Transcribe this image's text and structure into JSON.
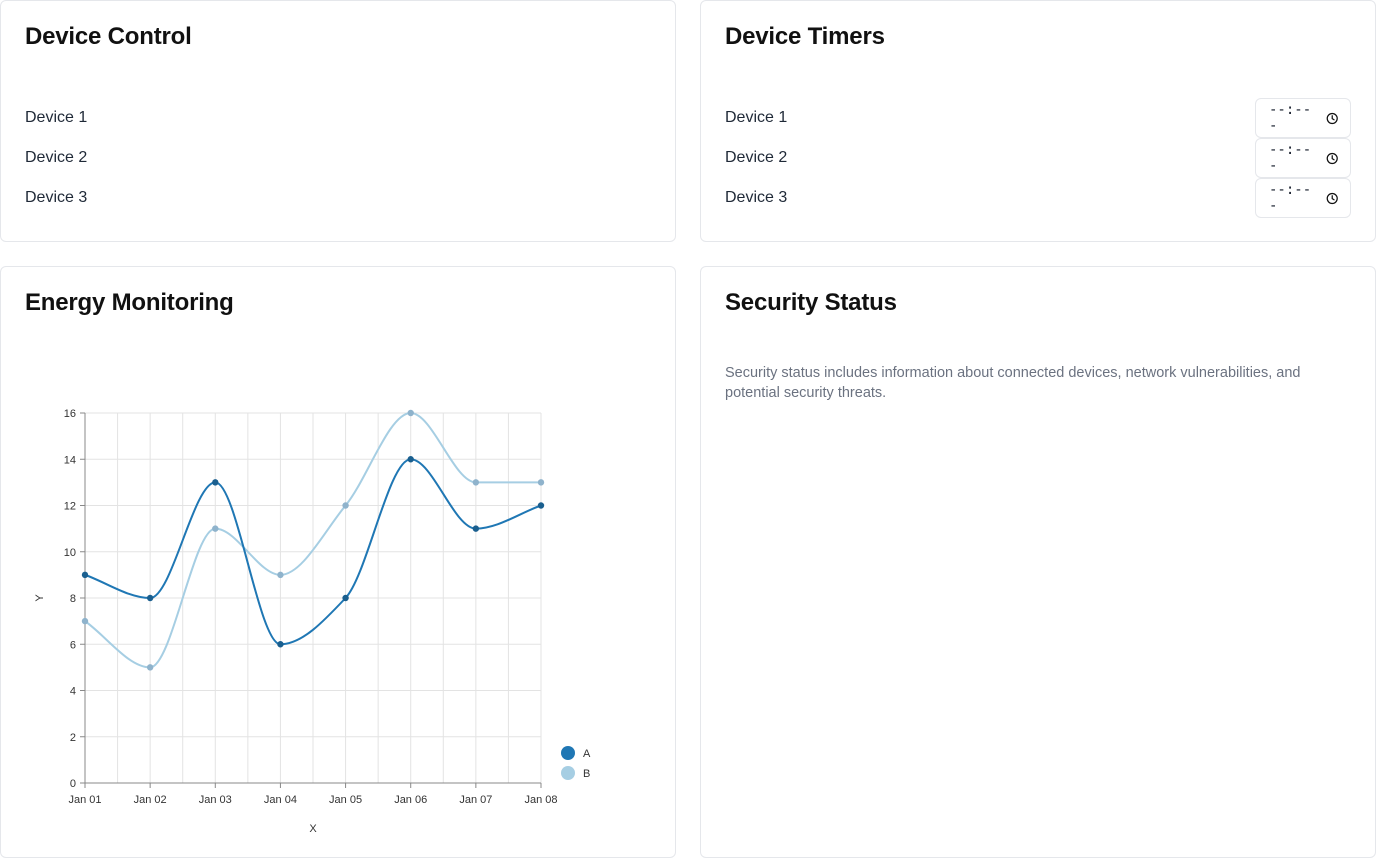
{
  "device_control": {
    "title": "Device Control",
    "devices": [
      "Device 1",
      "Device 2",
      "Device 3"
    ]
  },
  "device_timers": {
    "title": "Device Timers",
    "devices": [
      {
        "label": "Device 1",
        "time_placeholder": "--:-- -"
      },
      {
        "label": "Device 2",
        "time_placeholder": "--:-- -"
      },
      {
        "label": "Device 3",
        "time_placeholder": "--:-- -"
      }
    ],
    "time_icon": "clock-icon"
  },
  "energy_monitoring": {
    "title": "Energy Monitoring"
  },
  "security_status": {
    "title": "Security Status",
    "description": "Security status includes information about connected devices, network vulnerabilities, and potential security threats."
  },
  "chart_data": {
    "type": "line",
    "categories": [
      "Jan 01",
      "Jan 02",
      "Jan 03",
      "Jan 04",
      "Jan 05",
      "Jan 06",
      "Jan 07",
      "Jan 08"
    ],
    "series": [
      {
        "name": "A",
        "values": [
          9,
          8,
          13,
          6,
          8,
          14,
          11,
          12
        ],
        "color": "#1f77b4"
      },
      {
        "name": "B",
        "values": [
          7,
          5,
          11,
          9,
          12,
          16,
          13,
          13
        ],
        "color": "#a6cee3"
      }
    ],
    "xlabel": "X",
    "ylabel": "Y",
    "ylim": [
      0,
      16
    ],
    "yticks": [
      0,
      2,
      4,
      6,
      8,
      10,
      12,
      14,
      16
    ],
    "grid": true,
    "legend_position": "bottom-right"
  }
}
